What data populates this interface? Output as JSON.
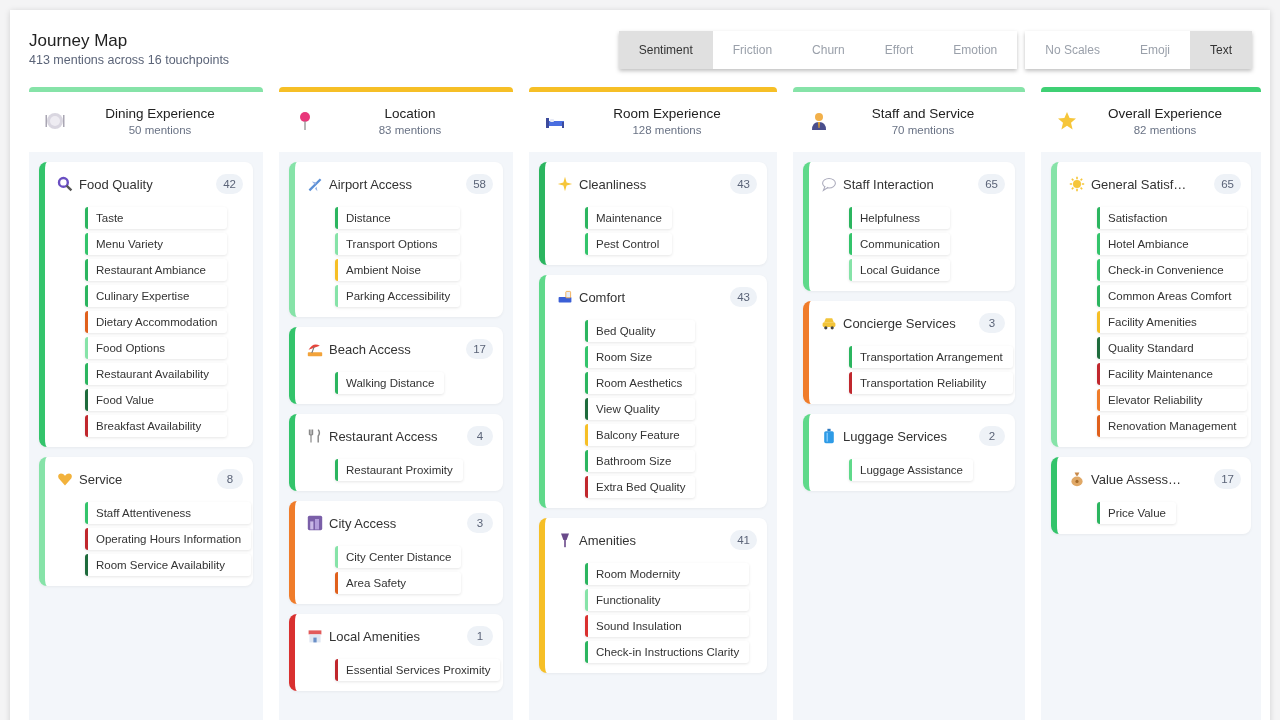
{
  "header": {
    "title": "Journey Map",
    "subtitle": "413 mentions across 16 touchpoints"
  },
  "metric_tabs": [
    {
      "label": "Sentiment",
      "selected": true
    },
    {
      "label": "Friction",
      "selected": false
    },
    {
      "label": "Churn",
      "selected": false
    },
    {
      "label": "Effort",
      "selected": false
    },
    {
      "label": "Emotion",
      "selected": false
    }
  ],
  "display_tabs": [
    {
      "label": "No Scales",
      "selected": false
    },
    {
      "label": "Emoji",
      "selected": false
    },
    {
      "label": "Text",
      "selected": true
    }
  ],
  "stages": [
    {
      "title": "Dining Experience",
      "mentions": "50 mentions",
      "color": "#86e3a8",
      "touchpoints": [
        {
          "title": "Food Quality",
          "count": "42",
          "color": "#33c46b",
          "items": [
            {
              "label": "Taste",
              "color": "#2bb55f"
            },
            {
              "label": "Menu Variety",
              "color": "#33c46b"
            },
            {
              "label": "Restaurant Ambiance",
              "color": "#2bb55f"
            },
            {
              "label": "Culinary Expertise",
              "color": "#2bb55f"
            },
            {
              "label": "Dietary Accommodation",
              "color": "#e0601c"
            },
            {
              "label": "Food Options",
              "color": "#86e3a8"
            },
            {
              "label": "Restaurant Availability",
              "color": "#2bb55f"
            },
            {
              "label": "Food Value",
              "color": "#1e6b3c"
            },
            {
              "label": "Breakfast Availability",
              "color": "#c0272d"
            }
          ]
        },
        {
          "title": "Service",
          "count": "8",
          "color": "#86e3a8",
          "items": [
            {
              "label": "Staff Attentiveness",
              "color": "#33c46b"
            },
            {
              "label": "Operating Hours Information",
              "color": "#c0272d"
            },
            {
              "label": "Room Service Availability",
              "color": "#1e6b3c"
            }
          ]
        }
      ]
    },
    {
      "title": "Location",
      "mentions": "83 mentions",
      "color": "#f6bf26",
      "touchpoints": [
        {
          "title": "Airport Access",
          "count": "58",
          "color": "#86e3a8",
          "items": [
            {
              "label": "Distance",
              "color": "#2bb55f"
            },
            {
              "label": "Transport Options",
              "color": "#86e3a8"
            },
            {
              "label": "Ambient Noise",
              "color": "#f6bf26"
            },
            {
              "label": "Parking Accessibility",
              "color": "#86e3a8"
            }
          ]
        },
        {
          "title": "Beach Access",
          "count": "17",
          "color": "#33c46b",
          "items": [
            {
              "label": "Walking Distance",
              "color": "#2bb55f"
            }
          ]
        },
        {
          "title": "Restaurant Access",
          "count": "4",
          "color": "#33c46b",
          "items": [
            {
              "label": "Restaurant Proximity",
              "color": "#2bb55f"
            }
          ]
        },
        {
          "title": "City Access",
          "count": "3",
          "color": "#f07c2a",
          "items": [
            {
              "label": "City Center Distance",
              "color": "#86e3a8"
            },
            {
              "label": "Area Safety",
              "color": "#e0601c"
            }
          ]
        },
        {
          "title": "Local Amenities",
          "count": "1",
          "color": "#d9302f",
          "items": [
            {
              "label": "Essential Services Proximity",
              "color": "#c0272d"
            }
          ]
        }
      ]
    },
    {
      "title": "Room Experience",
      "mentions": "128 mentions",
      "color": "#f6bf26",
      "touchpoints": [
        {
          "title": "Cleanliness",
          "count": "43",
          "color": "#2bb55f",
          "items": [
            {
              "label": "Maintenance",
              "color": "#2bb55f"
            },
            {
              "label": "Pest Control",
              "color": "#33c46b"
            }
          ]
        },
        {
          "title": "Comfort",
          "count": "43",
          "color": "#5fd98a",
          "items": [
            {
              "label": "Bed Quality",
              "color": "#2bb55f"
            },
            {
              "label": "Room Size",
              "color": "#33c46b"
            },
            {
              "label": "Room Aesthetics",
              "color": "#2bb55f"
            },
            {
              "label": "View Quality",
              "color": "#1e6b3c"
            },
            {
              "label": "Balcony Feature",
              "color": "#f6bf26"
            },
            {
              "label": "Bathroom Size",
              "color": "#2bb55f"
            },
            {
              "label": "Extra Bed Quality",
              "color": "#c0272d"
            }
          ]
        },
        {
          "title": "Amenities",
          "count": "41",
          "color": "#f6bf26",
          "items": [
            {
              "label": "Room Modernity",
              "color": "#2bb55f"
            },
            {
              "label": "Functionality",
              "color": "#86e3a8"
            },
            {
              "label": "Sound Insulation",
              "color": "#d9302f"
            },
            {
              "label": "Check-in Instructions Clarity",
              "color": "#2bb55f"
            }
          ]
        }
      ]
    },
    {
      "title": "Staff and Service",
      "mentions": "70 mentions",
      "color": "#86e3a8",
      "touchpoints": [
        {
          "title": "Staff Interaction",
          "count": "65",
          "color": "#5fd98a",
          "items": [
            {
              "label": "Helpfulness",
              "color": "#2bb55f"
            },
            {
              "label": "Communication",
              "color": "#33c46b"
            },
            {
              "label": "Local Guidance",
              "color": "#86e3a8"
            }
          ]
        },
        {
          "title": "Concierge Services",
          "count": "3",
          "color": "#f07c2a",
          "items": [
            {
              "label": "Transportation Arrangement",
              "color": "#2bb55f"
            },
            {
              "label": "Transportation Reliability",
              "color": "#c0272d"
            }
          ]
        },
        {
          "title": "Luggage Services",
          "count": "2",
          "color": "#5fd98a",
          "items": [
            {
              "label": "Luggage Assistance",
              "color": "#5fd98a"
            }
          ]
        }
      ]
    },
    {
      "title": "Overall Experience",
      "mentions": "82 mentions",
      "color": "#3fd074",
      "touchpoints": [
        {
          "title": "General Satisf…",
          "count": "65",
          "color": "#86e3a8",
          "items": [
            {
              "label": "Satisfaction",
              "color": "#2bb55f"
            },
            {
              "label": "Hotel Ambiance",
              "color": "#33c46b"
            },
            {
              "label": "Check-in Convenience",
              "color": "#33c46b"
            },
            {
              "label": "Common Areas Comfort",
              "color": "#2bb55f"
            },
            {
              "label": "Facility Amenities",
              "color": "#f6bf26"
            },
            {
              "label": "Quality Standard",
              "color": "#1e6b3c"
            },
            {
              "label": "Facility Maintenance",
              "color": "#c0272d"
            },
            {
              "label": "Elevator Reliability",
              "color": "#f07c2a"
            },
            {
              "label": "Renovation Management",
              "color": "#e0601c"
            }
          ]
        },
        {
          "title": "Value Assess…",
          "count": "17",
          "color": "#33c46b",
          "items": [
            {
              "label": "Price Value",
              "color": "#2bb55f"
            }
          ]
        }
      ]
    }
  ]
}
